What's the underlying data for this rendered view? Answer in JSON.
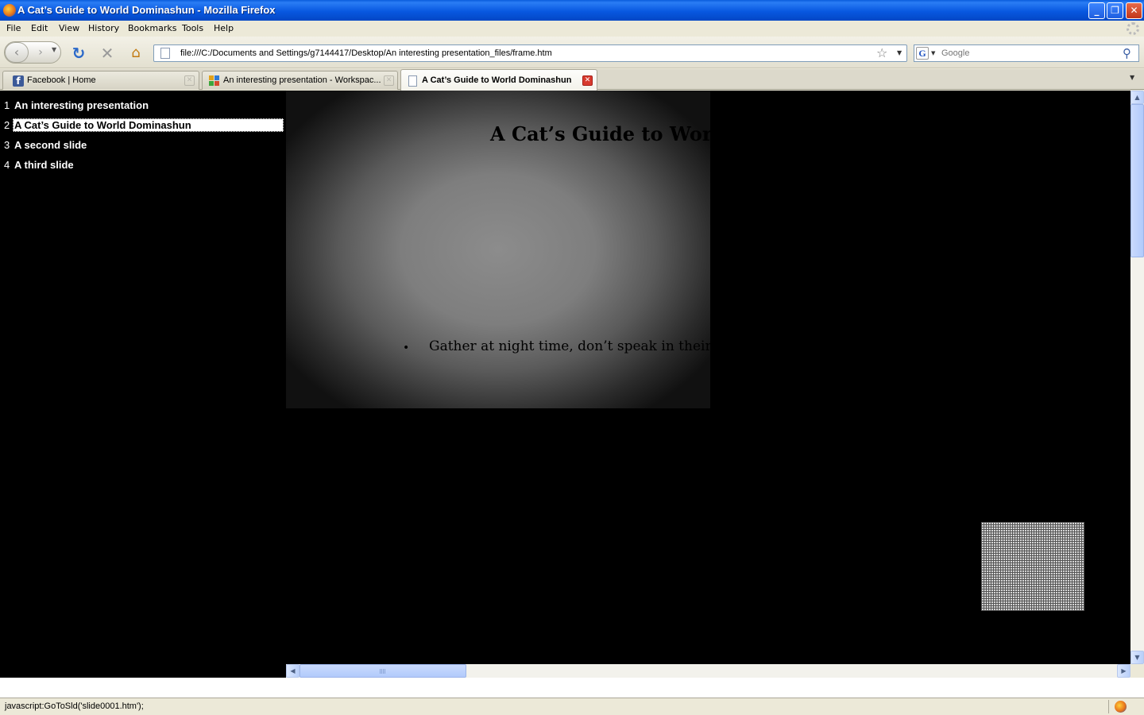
{
  "window": {
    "title": "A Cat’s Guide to World Dominashun - Mozilla Firefox",
    "controls": {
      "minimize": "_",
      "maximize": "❐",
      "close": "✕"
    }
  },
  "menu": [
    "File",
    "Edit",
    "View",
    "History",
    "Bookmarks",
    "Tools",
    "Help"
  ],
  "nav": {
    "back_glyph": "‹",
    "forward_glyph": "›",
    "reload_glyph": "↻",
    "stop_glyph": "✕",
    "home_glyph": "⌂",
    "url": "file:///C:/Documents and Settings/g7144417/Desktop/An interesting presentation_files/frame.htm",
    "bookmark_glyph": "☆",
    "search_engine": "G",
    "search_placeholder": "Google",
    "search_glyph": "⚲"
  },
  "tabs": [
    {
      "label": "Facebook | Home",
      "icon": "facebook-icon",
      "active": false
    },
    {
      "label": "An interesting presentation - Workspac...",
      "icon": "workspace-icon",
      "active": false
    },
    {
      "label": "A Cat’s Guide to World Dominashun",
      "icon": "page-icon",
      "active": true
    }
  ],
  "tab_close_glyph": "✕",
  "outline": [
    {
      "num": "1",
      "title": "An interesting presentation",
      "selected": false
    },
    {
      "num": "2",
      "title": "A Cat’s Guide to World Dominashun",
      "selected": true
    },
    {
      "num": "3",
      "title": "A second slide",
      "selected": false
    },
    {
      "num": "4",
      "title": "A third slide",
      "selected": false
    }
  ],
  "slide": {
    "title": "A Cat’s Guide to World Dominashun",
    "bullet_glyph": "•",
    "bullet": "Gather at night time, don’t speak in their presence"
  },
  "scroll": {
    "up": "▲",
    "down": "▼",
    "left": "◀",
    "right": "▶"
  },
  "status": {
    "text": "javascript:GoToSld('slide0001.htm');"
  },
  "colors": {
    "titlebar": "#0858e0",
    "facebook": "#3b5998",
    "active_tab_close": "#d83a2e"
  }
}
